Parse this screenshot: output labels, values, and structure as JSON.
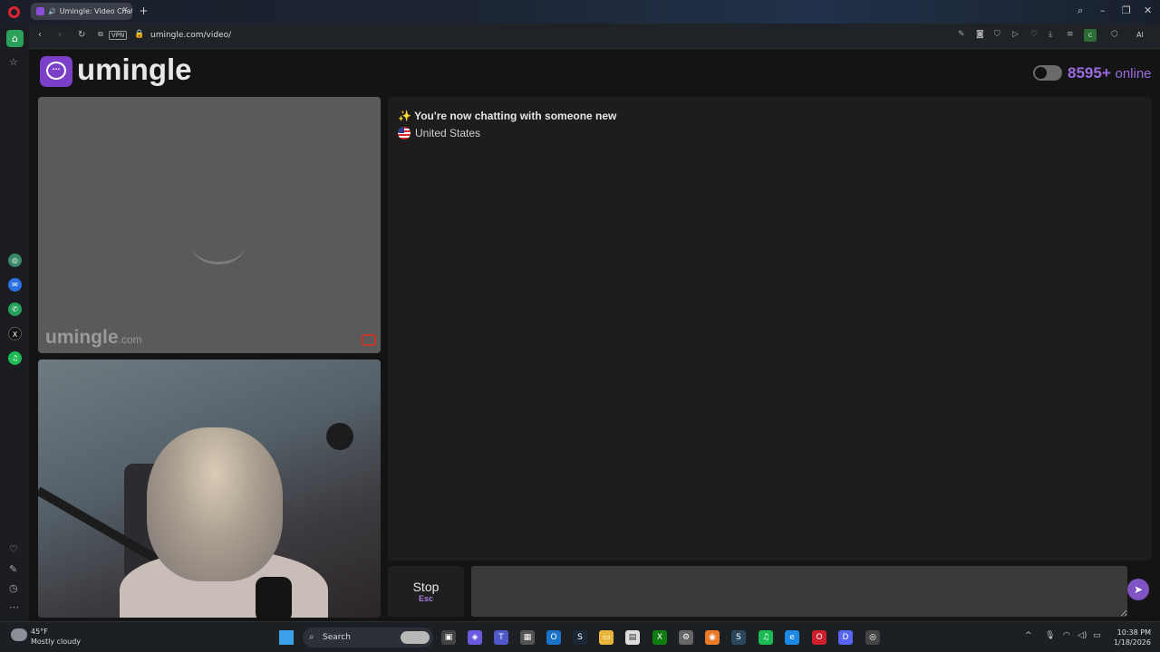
{
  "browser": {
    "tab_title": "Umingle: Video Chat",
    "url": "umingle.com/video/",
    "vpn_label": "VPN",
    "ext_c_label": "c",
    "ai_label": "AI"
  },
  "site": {
    "logo_text": "umingle",
    "online_count": "8595+",
    "online_label": "online",
    "watermark": "umingle",
    "watermark_suffix": ".com"
  },
  "chat": {
    "system_message": "You're now chatting with someone new",
    "system_icon": "sparkle-icon",
    "country": "United States"
  },
  "controls": {
    "stop_label": "Stop",
    "stop_shortcut": "Esc",
    "input_value": ""
  },
  "taskbar": {
    "temperature": "45°F",
    "weather": "Mostly cloudy",
    "search_label": "Search",
    "time": "10:38 PM",
    "date": "1/18/2026"
  },
  "colors": {
    "brand": "#7b3fc8",
    "online_text": "#9b6ce0",
    "send_button": "#7f53c4",
    "page_bg": "#141414"
  }
}
